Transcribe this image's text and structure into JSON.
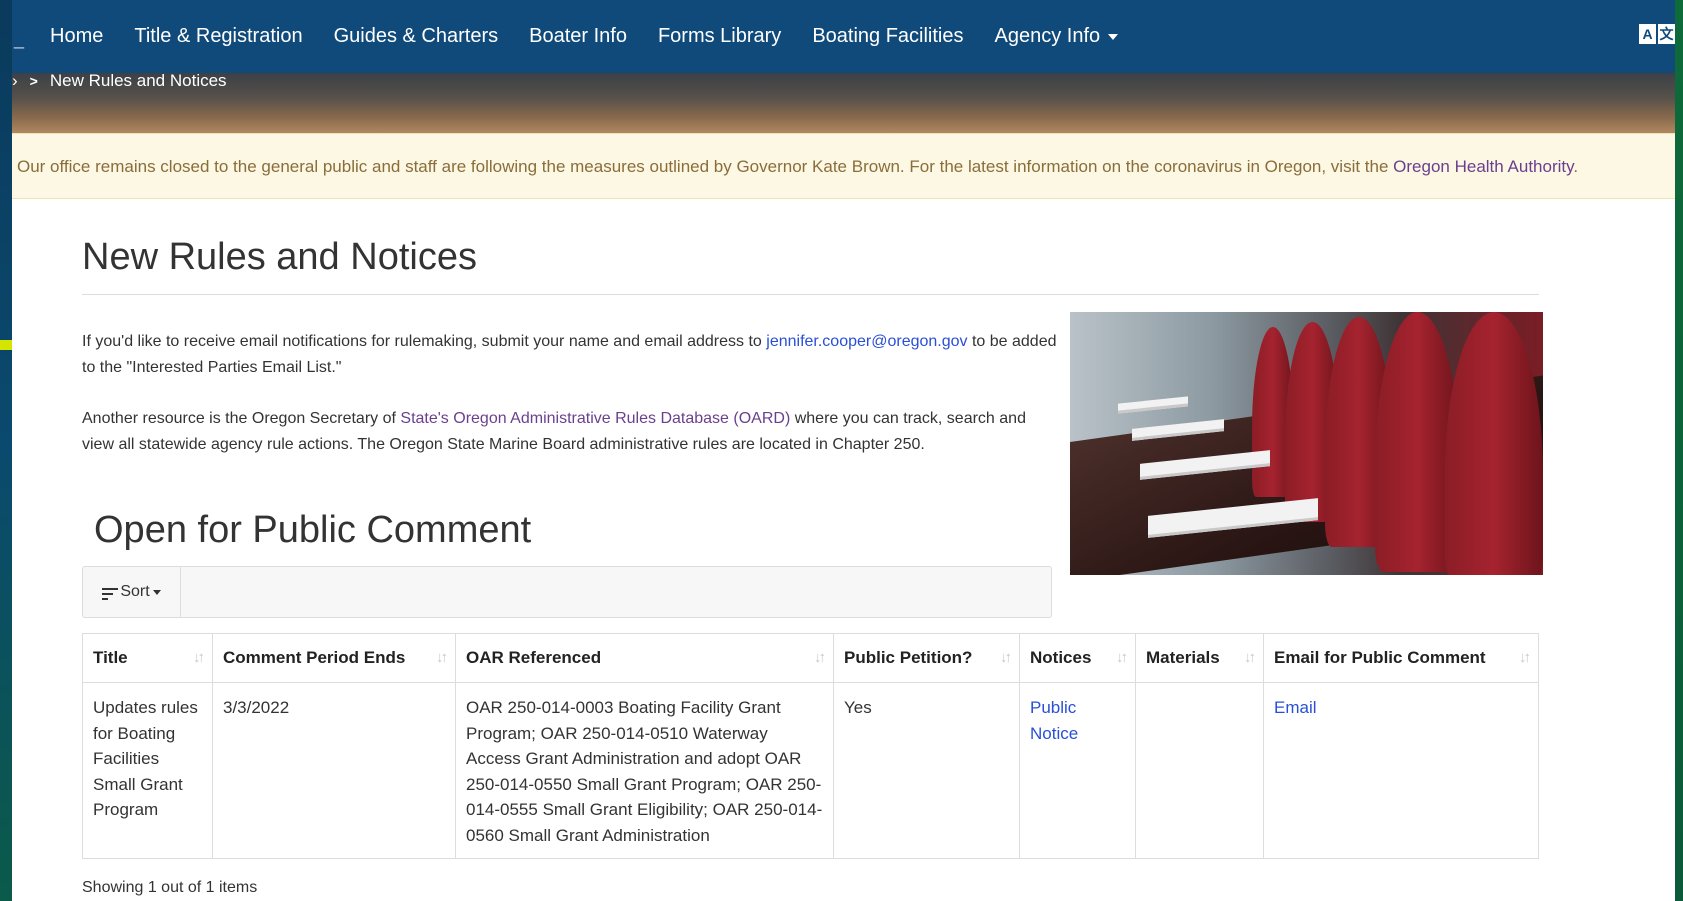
{
  "nav": {
    "items": [
      "Home",
      "Title & Registration",
      "Guides & Charters",
      "Boater Info",
      "Forms Library",
      "Boating Facilities",
      "Agency Info"
    ],
    "a11y_badges": [
      "A",
      "文"
    ]
  },
  "breadcrumb": {
    "current": "New Rules and Notices"
  },
  "alert": {
    "text": "Our office remains closed to the general public and staff are following the measures outlined by Governor Kate Brown. For the latest information on the coronavirus in Oregon, visit the ",
    "link": "Oregon Health Authority",
    "end": "."
  },
  "page": {
    "title": "New Rules and Notices",
    "intro1_before": "If you'd like to receive email notifications for rulemaking, submit your name and email address to ",
    "intro1_link": "jennifer.cooper@oregon.gov",
    "intro1_after": " to be added to the \"Interested Parties Email List.\"",
    "intro2_before": "Another resource is the Oregon Secretary of ",
    "intro2_link": "State's Oregon Administrative Rules Database (OARD)",
    "intro2_after": " where you can track, search and view all statewide agency rule actions. The Oregon State Marine Board administrative rules are located in Chapter 250.",
    "section_title": "Open for Public Comment"
  },
  "toolbar": {
    "sort_label": "Sort"
  },
  "table": {
    "columns": [
      "Title",
      "Comment Period Ends",
      "OAR Referenced",
      "Public Petition?",
      "Notices",
      "Materials",
      "Email for Public Comment"
    ],
    "rows": [
      {
        "title": "Updates rules for Boating Facilities Small Grant Program",
        "comment_period_ends": "3/3/2022",
        "oar_referenced": "OAR 250-014-0003 Boating Facility Grant Program; OAR 250-014-0510 Waterway Access Grant Administration and adopt OAR 250-014-0550 Small Grant Program; OAR 250-014-0555 Small Grant Eligibility; OAR 250-014-0560 Small Grant Administration",
        "public_petition": "Yes",
        "notices": "Public Notice",
        "materials": "",
        "email": "Email"
      }
    ]
  },
  "footer": {
    "count_text": "Showing 1 out of 1 items"
  },
  "colors": {
    "navbar": "#0f4a7a",
    "link": "#2a4fd6",
    "visited_link": "#6b3f8f",
    "alert_bg": "#fcf8e3",
    "alert_text": "#8a6d3b"
  }
}
